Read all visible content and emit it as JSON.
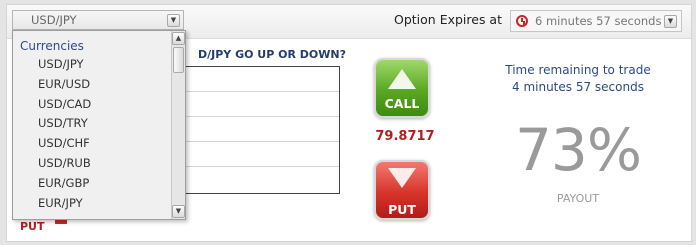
{
  "currency_select": {
    "value": "USD/JPY",
    "arrow_icon": "chevron-down-icon"
  },
  "expiry": {
    "label": "Option Expires at",
    "value": "6 minutes 57 seconds",
    "icon": "clock-icon",
    "icon_color": "#c62828"
  },
  "question": "D/JPY GO UP OR DOWN?",
  "dropdown": {
    "group_label": "Currencies",
    "options": [
      "USD/JPY",
      "EUR/USD",
      "USD/CAD",
      "USD/TRY",
      "USD/CHF",
      "USD/RUB",
      "EUR/GBP",
      "EUR/JPY"
    ]
  },
  "put_hint": "PUT",
  "call_button": {
    "label": "CALL",
    "color": "#5aa722"
  },
  "put_button": {
    "label": "PUT",
    "color": "#d8342a"
  },
  "price": "79.8717",
  "time_remaining": {
    "line1": "Time remaining to trade",
    "line2": "4 minutes 57 seconds"
  },
  "payout": {
    "percent": "73%",
    "label": "PAYOUT"
  }
}
